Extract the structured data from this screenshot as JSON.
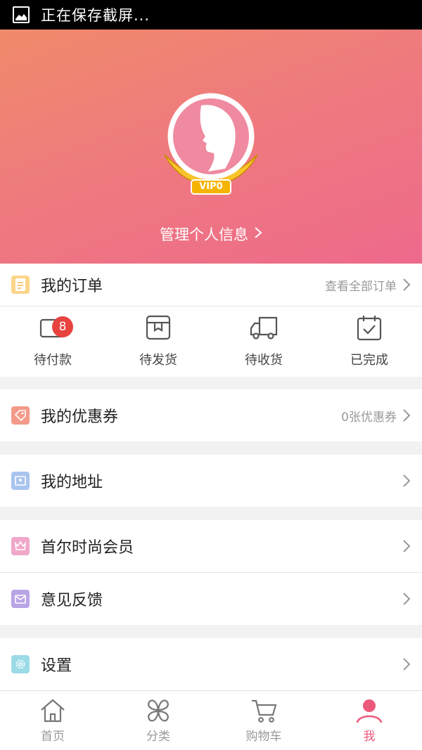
{
  "status_bar": {
    "text": "正在保存截屏..."
  },
  "profile": {
    "vip_label": "VIP0",
    "manage_label": "管理个人信息"
  },
  "orders_header": {
    "title": "我的订单",
    "view_all": "查看全部订单"
  },
  "order_statuses": [
    {
      "label": "待付款",
      "badge": "8"
    },
    {
      "label": "待发货"
    },
    {
      "label": "待收货"
    },
    {
      "label": "已完成"
    }
  ],
  "menu": {
    "coupons": {
      "label": "我的优惠券",
      "value": "0张优惠券"
    },
    "address": {
      "label": "我的地址"
    },
    "membership": {
      "label": "首尔时尚会员"
    },
    "feedback": {
      "label": "意见反馈"
    },
    "settings": {
      "label": "设置"
    }
  },
  "tabbar": [
    {
      "label": "首页",
      "icon": "home-icon"
    },
    {
      "label": "分类",
      "icon": "category-icon"
    },
    {
      "label": "购物车",
      "icon": "cart-icon"
    },
    {
      "label": "我",
      "icon": "user-icon",
      "active": true
    }
  ],
  "colors": {
    "accent": "#ec5a7b",
    "badge": "#e8433f",
    "hero_start": "#f08a6a",
    "hero_end": "#ee6a8c"
  }
}
